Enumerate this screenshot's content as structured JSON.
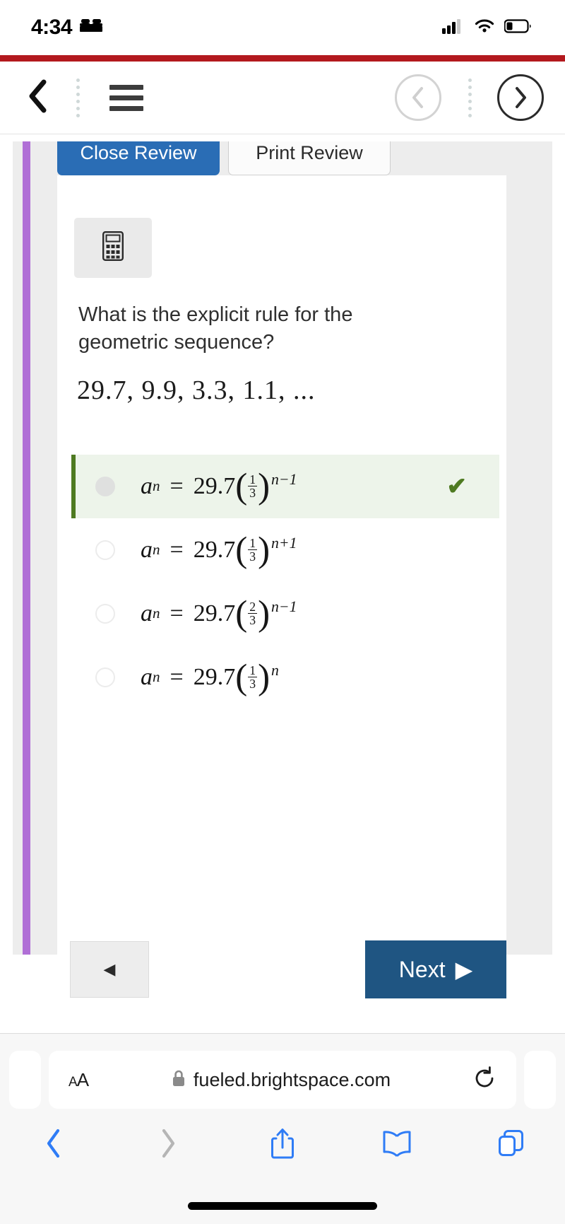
{
  "status_bar": {
    "time": "4:34",
    "sleep_icon": "bed-icon",
    "cellular_icon": "cellular-signal-icon",
    "wifi_icon": "wifi-icon",
    "battery_icon": "battery-low-icon"
  },
  "app_bar": {
    "back_icon": "chevron-left-icon",
    "menu_icon": "hamburger-menu-icon",
    "prev_icon": "circle-chevron-left-icon",
    "next_icon": "circle-chevron-right-icon",
    "drag_handle_icon": "vertical-dots-icon"
  },
  "quiz": {
    "close_review_label": "Close Review",
    "print_review_label": "Print Review",
    "calculator_icon": "calculator-icon",
    "question": "What is the explicit rule for the geometric sequence?",
    "sequence": "29.7, 9.9, 3.3, 1.1, ...",
    "correct_mark_icon": "check-icon",
    "options": [
      {
        "id": "option-a",
        "var": "a",
        "sub": "n",
        "coefficient": "29.7",
        "numerator": "1",
        "denominator": "3",
        "exponent": "n−1",
        "selected": true,
        "correct": true
      },
      {
        "id": "option-b",
        "var": "a",
        "sub": "n",
        "coefficient": "29.7",
        "numerator": "1",
        "denominator": "3",
        "exponent": "n+1",
        "selected": false,
        "correct": false
      },
      {
        "id": "option-c",
        "var": "a",
        "sub": "n",
        "coefficient": "29.7",
        "numerator": "2",
        "denominator": "3",
        "exponent": "n−1",
        "selected": false,
        "correct": false
      },
      {
        "id": "option-d",
        "var": "a",
        "sub": "n",
        "coefficient": "29.7",
        "numerator": "1",
        "denominator": "3",
        "exponent": "n",
        "selected": false,
        "correct": false
      }
    ],
    "prev_button_label": "◀",
    "next_button_label": "Next",
    "next_button_arrow": "▶"
  },
  "browser": {
    "text_size_label_small": "A",
    "text_size_label_large": "A",
    "lock_icon": "lock-icon",
    "url": "fueled.brightspace.com",
    "reload_icon": "reload-icon",
    "back_icon": "chevron-left-icon",
    "forward_icon": "chevron-right-icon",
    "share_icon": "share-icon",
    "bookmarks_icon": "book-icon",
    "tabs_icon": "tabs-icon"
  },
  "colors": {
    "accent_red": "#b3191e",
    "primary_blue": "#2a6db5",
    "next_blue": "#1f5582",
    "correct_green": "#4e7a21",
    "correct_bg": "#edf4ea",
    "purple_bar": "#b06fd6",
    "safari_blue": "#2f7cf6"
  }
}
